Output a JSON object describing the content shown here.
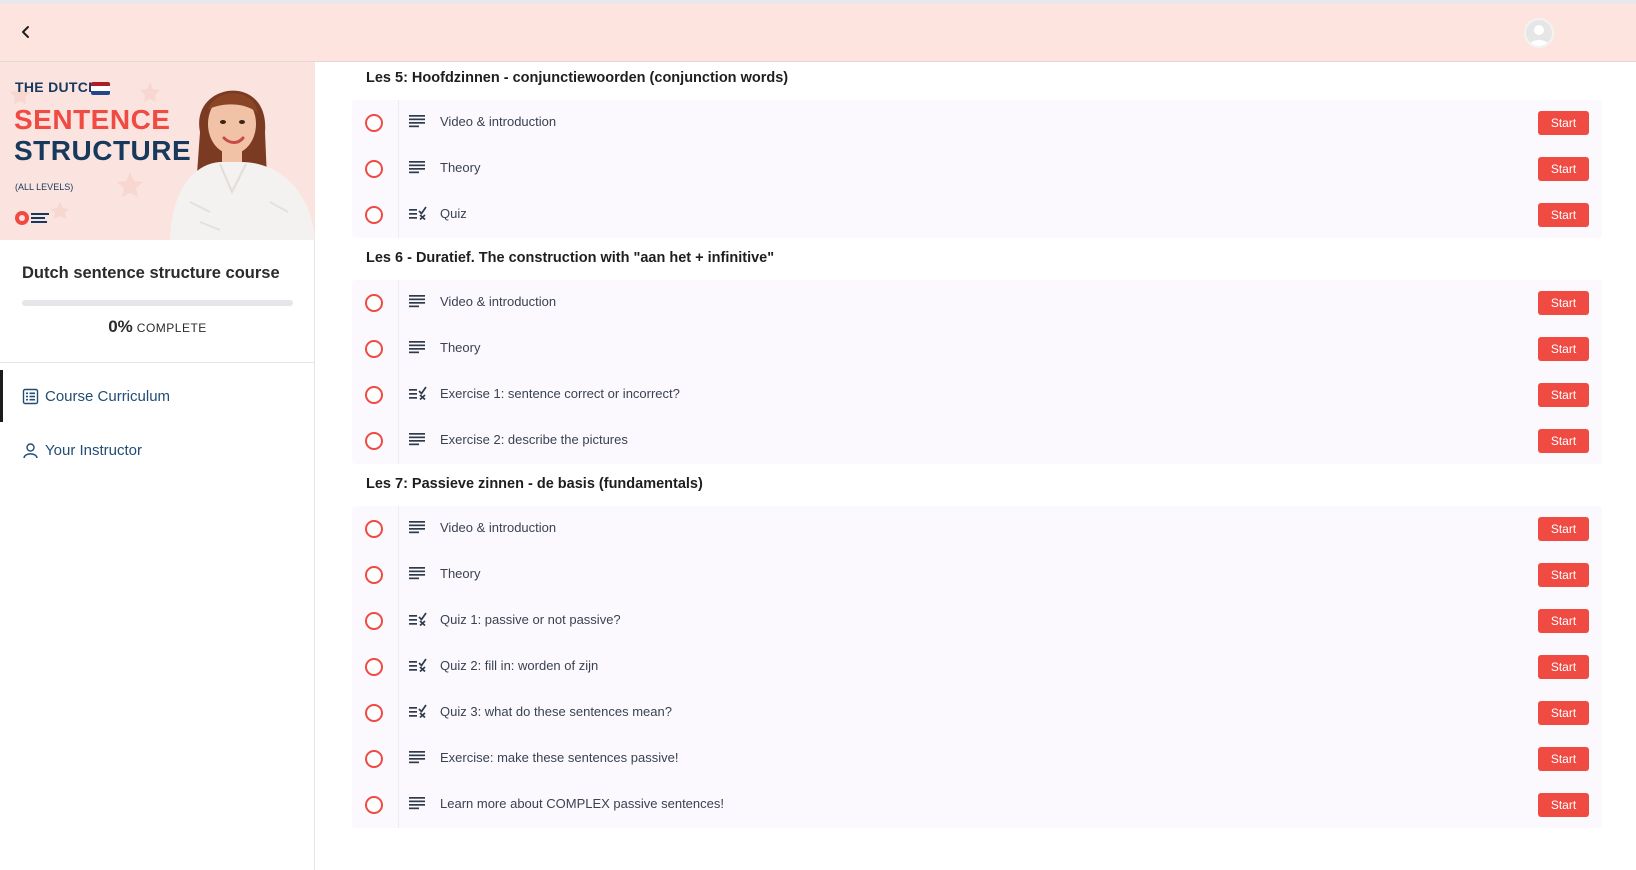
{
  "hero": {
    "the_dutch": "THE DUTCH",
    "sentence": "SENTENCE",
    "structure": "STRUCTURE",
    "levels": "(ALL LEVELS)",
    "flag_colors": [
      "#ae1c28",
      "#ffffff",
      "#21468b"
    ]
  },
  "course": {
    "title": "Dutch sentence structure course",
    "progress": 0,
    "progress_pct": "0%",
    "progress_word": "COMPLETE"
  },
  "nav": {
    "curriculum": "Course Curriculum",
    "instructor": "Your Instructor"
  },
  "icons": {
    "back": "chevron-left-icon",
    "avatar": "user-avatar-icon",
    "curriculum": "list-icon",
    "instructor": "user-icon",
    "text_lesson": "text-lines-icon",
    "quiz_lesson": "quiz-check-icon"
  },
  "colors": {
    "accent": "#ef4b43",
    "topbar": "#fde4df",
    "navy": "#17395c",
    "nav_text": "#224d73"
  },
  "sections": [
    {
      "title": "Les 5: Hoofdzinnen - conjunctiewoorden (conjunction words)",
      "lessons": [
        {
          "type": "text",
          "title": "Video & introduction",
          "action": "Start"
        },
        {
          "type": "text",
          "title": "Theory",
          "action": "Start"
        },
        {
          "type": "quiz",
          "title": "Quiz",
          "action": "Start"
        }
      ]
    },
    {
      "title": "Les 6 - Duratief. The construction with \"aan het + infinitive\"",
      "lessons": [
        {
          "type": "text",
          "title": "Video & introduction",
          "action": "Start"
        },
        {
          "type": "text",
          "title": "Theory",
          "action": "Start"
        },
        {
          "type": "quiz",
          "title": "Exercise 1: sentence correct or incorrect?",
          "action": "Start"
        },
        {
          "type": "text",
          "title": "Exercise 2: describe the pictures",
          "action": "Start"
        }
      ]
    },
    {
      "title": "Les 7: Passieve zinnen - de basis (fundamentals)",
      "lessons": [
        {
          "type": "text",
          "title": "Video & introduction",
          "action": "Start"
        },
        {
          "type": "text",
          "title": "Theory",
          "action": "Start"
        },
        {
          "type": "quiz",
          "title": "Quiz 1: passive or not passive?",
          "action": "Start"
        },
        {
          "type": "quiz",
          "title": "Quiz 2: fill in: worden of zijn",
          "action": "Start"
        },
        {
          "type": "quiz",
          "title": "Quiz 3: what do these sentences mean?",
          "action": "Start"
        },
        {
          "type": "text",
          "title": "Exercise: make these sentences passive!",
          "action": "Start"
        },
        {
          "type": "text",
          "title": "Learn more about COMPLEX passive sentences!",
          "action": "Start"
        }
      ]
    }
  ]
}
